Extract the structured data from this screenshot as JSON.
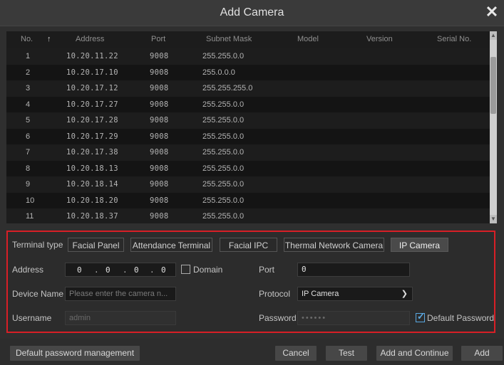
{
  "dialog": {
    "title": "Add Camera",
    "close_glyph": "✕"
  },
  "table": {
    "columns": {
      "no": "No.",
      "sort_glyph": "↑",
      "address": "Address",
      "port": "Port",
      "subnet": "Subnet Mask",
      "model": "Model",
      "version": "Version",
      "serial": "Serial No."
    },
    "rows": [
      {
        "no": "1",
        "address": "10.20.11.22",
        "port": "9008",
        "subnet": "255.255.0.0"
      },
      {
        "no": "2",
        "address": "10.20.17.10",
        "port": "9008",
        "subnet": "255.0.0.0"
      },
      {
        "no": "3",
        "address": "10.20.17.12",
        "port": "9008",
        "subnet": "255.255.255.0"
      },
      {
        "no": "4",
        "address": "10.20.17.27",
        "port": "9008",
        "subnet": "255.255.0.0"
      },
      {
        "no": "5",
        "address": "10.20.17.28",
        "port": "9008",
        "subnet": "255.255.0.0"
      },
      {
        "no": "6",
        "address": "10.20.17.29",
        "port": "9008",
        "subnet": "255.255.0.0"
      },
      {
        "no": "7",
        "address": "10.20.17.38",
        "port": "9008",
        "subnet": "255.255.0.0"
      },
      {
        "no": "8",
        "address": "10.20.18.13",
        "port": "9008",
        "subnet": "255.255.0.0"
      },
      {
        "no": "9",
        "address": "10.20.18.14",
        "port": "9008",
        "subnet": "255.255.0.0"
      },
      {
        "no": "10",
        "address": "10.20.18.20",
        "port": "9008",
        "subnet": "255.255.0.0"
      },
      {
        "no": "11",
        "address": "10.20.18.37",
        "port": "9008",
        "subnet": "255.255.0.0"
      }
    ]
  },
  "form": {
    "terminal_type_label": "Terminal type",
    "terminal_types": [
      "Facial Panel",
      "Attendance Terminal",
      "Facial IPC",
      "Thermal Network Camera",
      "IP Camera"
    ],
    "selected_terminal_type": "IP Camera",
    "address_label": "Address",
    "address_octets": [
      "0",
      "0",
      "0",
      "0"
    ],
    "domain_label": "Domain",
    "domain_checked": false,
    "port_label": "Port",
    "port_value": "0",
    "device_name_label": "Device Name",
    "device_name_placeholder": "Please enter the camera n...",
    "protocol_label": "Protocol",
    "protocol_value": "IP Camera",
    "username_label": "Username",
    "username_value": "admin",
    "password_label": "Password",
    "password_value": "••••••",
    "default_password_label": "Default Password",
    "default_password_checked": true
  },
  "footer": {
    "default_password_mgmt": "Default password management",
    "cancel": "Cancel",
    "test": "Test",
    "add_continue": "Add and Continue",
    "add": "Add"
  },
  "colors": {
    "highlight_border": "#d81f26",
    "check_accent": "#5aa7e0"
  }
}
